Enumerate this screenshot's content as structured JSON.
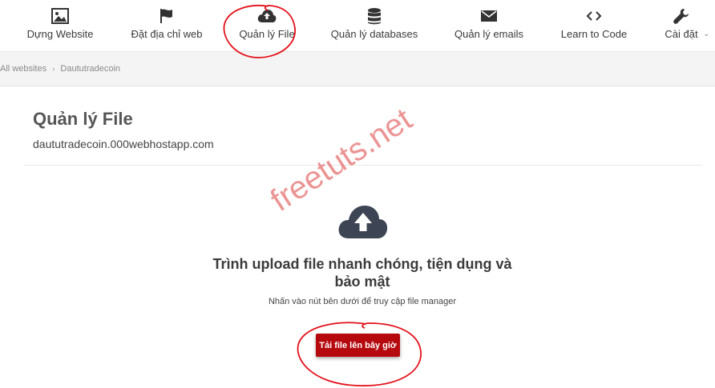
{
  "nav": {
    "items": [
      {
        "label": "Dựng Website",
        "icon": "image-icon"
      },
      {
        "label": "Đặt địa chỉ web",
        "icon": "flag-icon"
      },
      {
        "label": "Quản lý File",
        "icon": "cloud-upload-icon"
      },
      {
        "label": "Quản lý databases",
        "icon": "database-icon"
      },
      {
        "label": "Quản lý emails",
        "icon": "envelope-icon"
      },
      {
        "label": "Learn to Code",
        "icon": "code-icon"
      },
      {
        "label": "Cài đặt",
        "icon": "wrench-icon"
      }
    ],
    "settings_caret": "⌄"
  },
  "breadcrumb": {
    "root": "All websites",
    "separator": "›",
    "current": "Daututradecoin"
  },
  "page": {
    "title": "Quản lý File",
    "domain": "daututradecoin.000webhostapp.com"
  },
  "upload": {
    "icon": "cloud-upload-icon",
    "heading_line1": "Trình upload file nhanh chóng, tiện dụng và",
    "heading_line2": "bảo mật",
    "subtext": "Nhấn vào nút bên dưới để truy cập file manager",
    "button_label": "Tải file lên bây giờ"
  },
  "watermark": {
    "text": "freetuts.net"
  },
  "colors": {
    "accent": "#b5090e",
    "annotation": "#e3101a",
    "icon_dark": "#3d4453"
  }
}
